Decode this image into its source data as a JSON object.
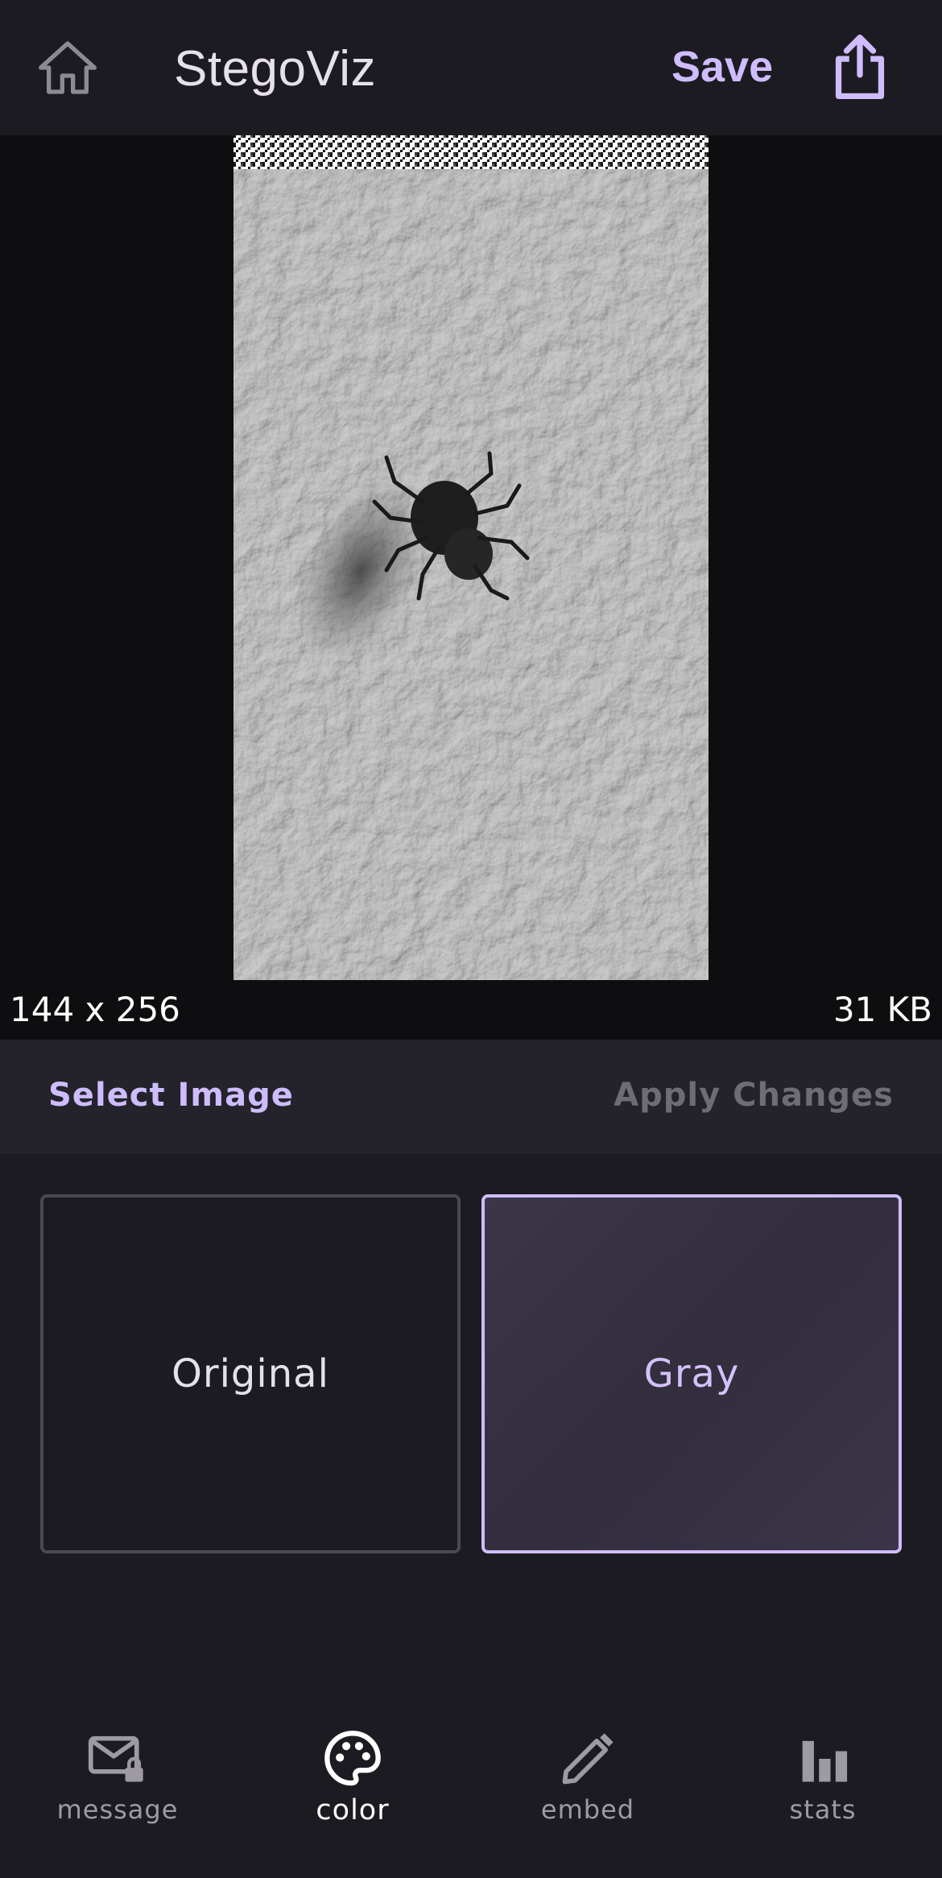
{
  "header": {
    "title": "StegoViz",
    "save_label": "Save",
    "home_icon": "home-icon",
    "share_icon": "share-icon"
  },
  "preview": {
    "dimensions": "144 x 256",
    "file_size": "31 KB"
  },
  "actions": {
    "select_image": "Select Image",
    "apply_changes": "Apply Changes"
  },
  "modes": {
    "selected": "Gray",
    "options": [
      {
        "label": "Original"
      },
      {
        "label": "Gray"
      }
    ]
  },
  "nav": {
    "active": "color",
    "items": [
      {
        "label": "message",
        "icon": "mail-lock-icon"
      },
      {
        "label": "color",
        "icon": "palette-icon"
      },
      {
        "label": "embed",
        "icon": "pencil-icon"
      },
      {
        "label": "stats",
        "icon": "bar-chart-icon"
      }
    ]
  },
  "colors": {
    "accent": "#cfbcff",
    "background": "#1c1b21",
    "surface": "#24232b",
    "preview_bg": "#0e0e11",
    "muted_text": "#706c76"
  }
}
